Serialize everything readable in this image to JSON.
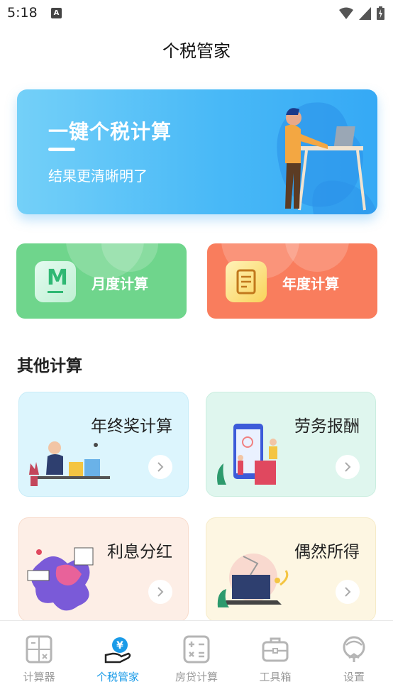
{
  "status_bar": {
    "time": "5:18",
    "notification_icon": "A"
  },
  "header": {
    "title": "个税管家"
  },
  "banner": {
    "headline": "一键个税计算",
    "subtitle": "结果更清晰明了"
  },
  "main_cards": [
    {
      "label": "月度计算",
      "icon": "M",
      "color": "#6fd58c"
    },
    {
      "label": "年度计算",
      "icon": "form-icon",
      "color": "#f97d5d"
    }
  ],
  "other": {
    "title": "其他计算",
    "items": [
      {
        "label": "年终奖计算",
        "bg": "#dcf5fd"
      },
      {
        "label": "劳务报酬",
        "bg": "#dff6ee"
      },
      {
        "label": "利息分红",
        "bg": "#fdeee6"
      },
      {
        "label": "偶然所得",
        "bg": "#fdf6e2"
      }
    ]
  },
  "tabbar": {
    "tabs": [
      {
        "label": "计算器",
        "active": false
      },
      {
        "label": "个税管家",
        "active": true
      },
      {
        "label": "房贷计算",
        "active": false
      },
      {
        "label": "工具箱",
        "active": false
      },
      {
        "label": "设置",
        "active": false
      }
    ]
  },
  "colors": {
    "accent": "#1a9be8",
    "inactive": "#999999"
  }
}
